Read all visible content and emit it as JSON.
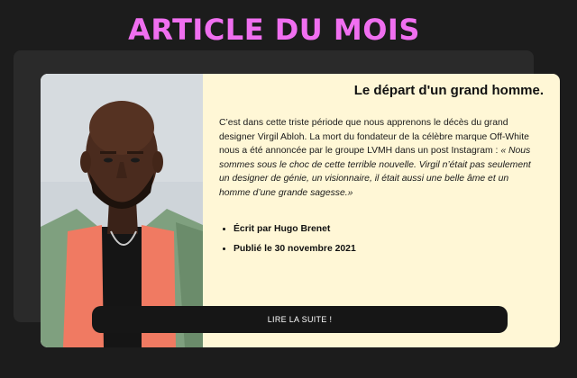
{
  "section": {
    "heading": "ARTICLE DU MOIS"
  },
  "article": {
    "title": "Le départ d'un grand homme.",
    "intro": "C’est dans cette triste période que nous apprenons le décès du grand designer Virgil Abloh. La mort du fondateur de la célèbre marque Off-White nous a été annoncée par le groupe LVMH dans un post Instagram : ",
    "quote": "« Nous sommes sous le choc de cette terrible nouvelle. Virgil n’était pas seulement un designer de génie, un visionnaire, il était aussi une belle âme et un homme d’une grande sagesse.»",
    "author": "Écrit par Hugo Brenet",
    "published": "Publié le 30 novembre 2021",
    "cta_label": "LIRE LA SUITE !"
  },
  "colors": {
    "accent": "#f06ff0",
    "background": "#1c1c1c",
    "card": "#fff7d6",
    "button": "#161616"
  }
}
